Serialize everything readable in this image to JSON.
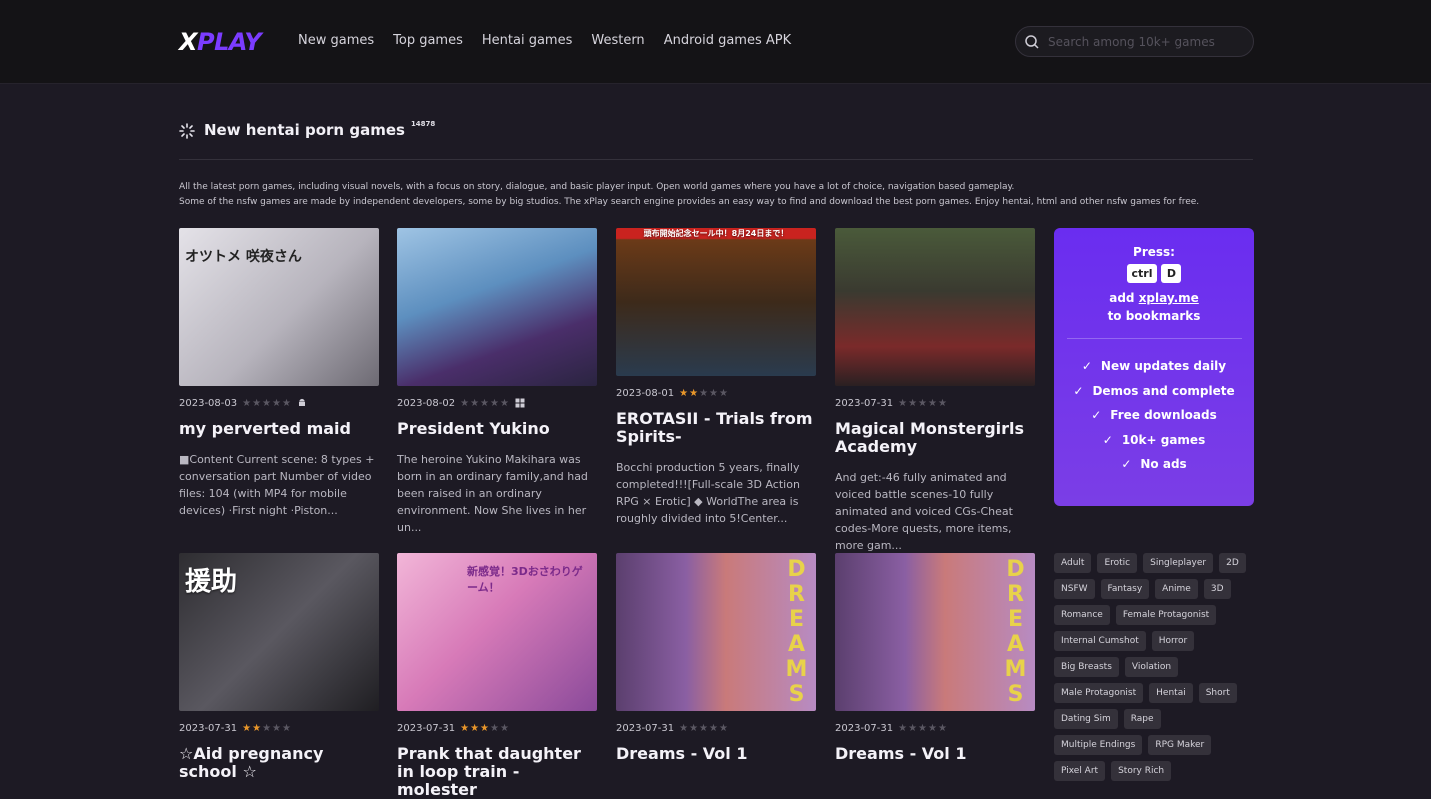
{
  "header": {
    "logo_x": "X",
    "logo_rest": "PLAY",
    "nav": [
      "New games",
      "Top games",
      "Hentai games",
      "Western",
      "Android games APK"
    ],
    "search_placeholder": "Search among 10k+ games"
  },
  "section": {
    "title": "New hentai porn games",
    "count": "14878",
    "intro_line1": "All the latest porn games, including visual novels, with a focus on story, dialogue, and basic player input. Open world games where you have a lot of choice, navigation based gameplay.",
    "intro_line2": "Some of the nsfw games are made by independent developers, some by big studios. The xPlay search engine provides an easy way to find and download the best porn games. Enjoy hentai, html and other nsfw games for free."
  },
  "games": [
    {
      "date": "2023-08-03",
      "rating": 0,
      "os_icon": "android-icon",
      "title": "my perverted maid",
      "desc": "■Content Current scene: 8 types + conversation part Number of video files: 104 (with MP4 for mobile devices) ·First night ·Piston...",
      "thumb_color": "#cfcdd3",
      "thumb_text": "オツトメ 咲夜さん"
    },
    {
      "date": "2023-08-02",
      "rating": 0,
      "os_icon": "windows-icon",
      "title": "President Yukino",
      "desc": "The heroine Yukino Makihara was born in an ordinary family,and had been raised in an ordinary environment. Now She lives in her un...",
      "thumb_color": "#6aa0c8",
      "thumb_text": ""
    },
    {
      "date": "2023-08-01",
      "rating": 2,
      "os_icon": "",
      "title": "EROTASII - Trials from Spirits-",
      "desc": "Bocchi production 5 years, finally completed!!![Full-scale 3D Action RPG × Erotic] ◆ WorldThe area is roughly divided into 5!Center...",
      "thumb_color": "#5a2a1c",
      "thumb_text": "頭布開始記念セール中！8月24日まで！"
    },
    {
      "date": "2023-07-31",
      "rating": 0,
      "os_icon": "",
      "title": "Magical Monstergirls Academy",
      "desc": "And get:-46 fully animated and voiced battle scenes-10 fully animated and voiced CGs-Cheat codes-More quests, more items, more gam...",
      "thumb_color": "#3b3a2e",
      "thumb_text": ""
    },
    {
      "date": "2023-07-31",
      "rating": 2,
      "os_icon": "",
      "title": "☆Aid pregnancy school ☆",
      "desc": "",
      "thumb_color": "#2b2a2e",
      "thumb_text": "援助"
    },
    {
      "date": "2023-07-31",
      "rating": 3,
      "os_icon": "",
      "title": "Prank that daughter in loop train - molester",
      "desc": "",
      "thumb_color": "#d77ab8",
      "thumb_text": "新感覚！3Dおさわりゲーム！"
    },
    {
      "date": "2023-07-31",
      "rating": 0,
      "os_icon": "",
      "title": "Dreams - Vol 1",
      "desc": "",
      "thumb_color": "#8a5fa3",
      "thumb_text": "DREAMS"
    },
    {
      "date": "2023-07-31",
      "rating": 0,
      "os_icon": "",
      "title": "Dreams - Vol 1",
      "desc": "",
      "thumb_color": "#8a5fa3",
      "thumb_text": "DREAMS"
    }
  ],
  "promo": {
    "press": "Press:",
    "key1": "ctrl",
    "key2": "D",
    "add": "add",
    "site": "xplay.me",
    "to_bookmarks": "to bookmarks",
    "features": [
      "New updates daily",
      "Demos and complete",
      "Free downloads",
      "10k+ games",
      "No ads"
    ]
  },
  "tags": [
    "Adult",
    "Erotic",
    "Singleplayer",
    "2D",
    "NSFW",
    "Fantasy",
    "Anime",
    "3D",
    "Romance",
    "Female Protagonist",
    "Internal Cumshot",
    "Horror",
    "Big Breasts",
    "Violation",
    "Male Protagonist",
    "Hentai",
    "Short",
    "Dating Sim",
    "Rape",
    "Multiple Endings",
    "RPG Maker",
    "Pixel Art",
    "Story Rich"
  ]
}
